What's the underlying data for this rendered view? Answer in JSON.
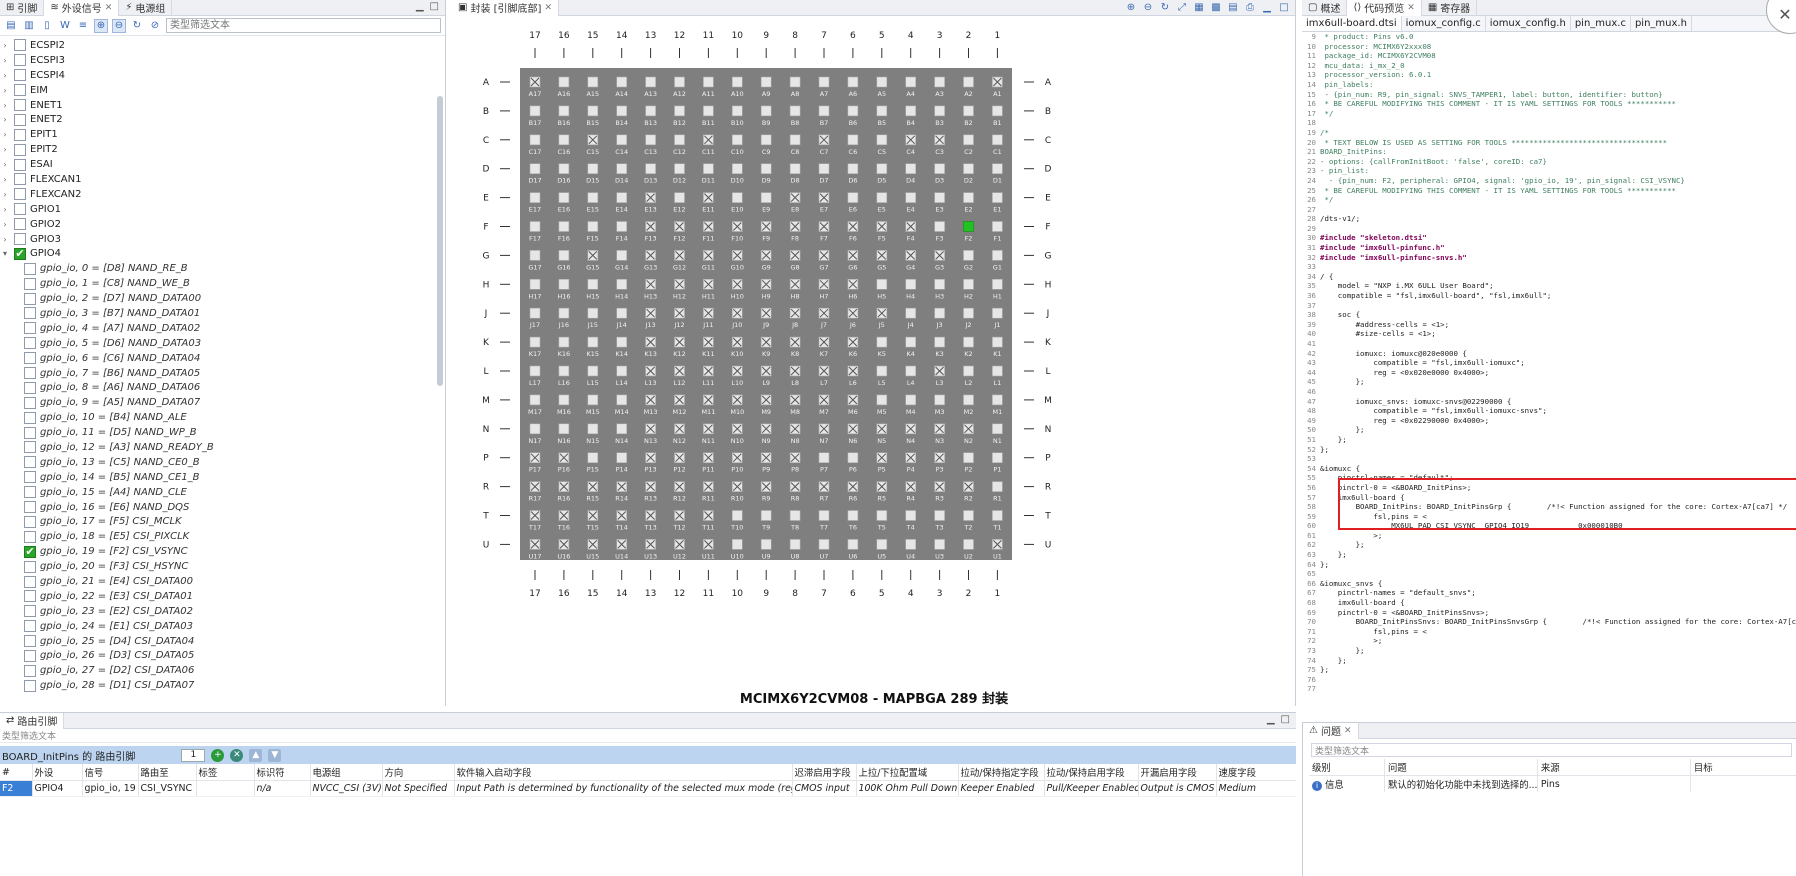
{
  "left_panel": {
    "tabs": [
      {
        "label": "引脚",
        "icon": "pin-icon"
      },
      {
        "label": "外设信号",
        "icon": "signal-icon",
        "active": true
      },
      {
        "label": "电源组",
        "icon": "power-icon"
      }
    ],
    "filter_placeholder": "类型筛选文本",
    "tree": [
      {
        "label": "ECSPI2",
        "checked": false
      },
      {
        "label": "ECSPI3",
        "checked": false
      },
      {
        "label": "ECSPI4",
        "checked": false
      },
      {
        "label": "EIM",
        "checked": false
      },
      {
        "label": "ENET1",
        "checked": false
      },
      {
        "label": "ENET2",
        "checked": false
      },
      {
        "label": "EPIT1",
        "checked": false
      },
      {
        "label": "EPIT2",
        "checked": false
      },
      {
        "label": "ESAI",
        "checked": false
      },
      {
        "label": "FLEXCAN1",
        "checked": false
      },
      {
        "label": "FLEXCAN2",
        "checked": false
      },
      {
        "label": "GPIO1",
        "checked": false
      },
      {
        "label": "GPIO2",
        "checked": false
      },
      {
        "label": "GPIO3",
        "checked": false
      },
      {
        "label": "GPIO4",
        "checked": true,
        "expanded": true
      },
      {
        "label": "gpio_io, 0 = [D8] NAND_RE_B",
        "child": true
      },
      {
        "label": "gpio_io, 1 = [C8] NAND_WE_B",
        "child": true
      },
      {
        "label": "gpio_io, 2 = [D7] NAND_DATA00",
        "child": true
      },
      {
        "label": "gpio_io, 3 = [B7] NAND_DATA01",
        "child": true
      },
      {
        "label": "gpio_io, 4 = [A7] NAND_DATA02",
        "child": true
      },
      {
        "label": "gpio_io, 5 = [D6] NAND_DATA03",
        "child": true
      },
      {
        "label": "gpio_io, 6 = [C6] NAND_DATA04",
        "child": true
      },
      {
        "label": "gpio_io, 7 = [B6] NAND_DATA05",
        "child": true
      },
      {
        "label": "gpio_io, 8 = [A6] NAND_DATA06",
        "child": true
      },
      {
        "label": "gpio_io, 9 = [A5] NAND_DATA07",
        "child": true
      },
      {
        "label": "gpio_io, 10 = [B4] NAND_ALE",
        "child": true
      },
      {
        "label": "gpio_io, 11 = [D5] NAND_WP_B",
        "child": true
      },
      {
        "label": "gpio_io, 12 = [A3] NAND_READY_B",
        "child": true
      },
      {
        "label": "gpio_io, 13 = [C5] NAND_CE0_B",
        "child": true
      },
      {
        "label": "gpio_io, 14 = [B5] NAND_CE1_B",
        "child": true
      },
      {
        "label": "gpio_io, 15 = [A4] NAND_CLE",
        "child": true
      },
      {
        "label": "gpio_io, 16 = [E6] NAND_DQS",
        "child": true
      },
      {
        "label": "gpio_io, 17 = [F5] CSI_MCLK",
        "child": true
      },
      {
        "label": "gpio_io, 18 = [E5] CSI_PIXCLK",
        "child": true
      },
      {
        "label": "gpio_io, 19 = [F2] CSI_VSYNC",
        "child": true,
        "checked": true
      },
      {
        "label": "gpio_io, 20 = [F3] CSI_HSYNC",
        "child": true
      },
      {
        "label": "gpio_io, 21 = [E4] CSI_DATA00",
        "child": true
      },
      {
        "label": "gpio_io, 22 = [E3] CSI_DATA01",
        "child": true
      },
      {
        "label": "gpio_io, 23 = [E2] CSI_DATA02",
        "child": true
      },
      {
        "label": "gpio_io, 24 = [E1] CSI_DATA03",
        "child": true
      },
      {
        "label": "gpio_io, 25 = [D4] CSI_DATA04",
        "child": true
      },
      {
        "label": "gpio_io, 26 = [D3] CSI_DATA05",
        "child": true
      },
      {
        "label": "gpio_io, 27 = [D2] CSI_DATA06",
        "child": true
      },
      {
        "label": "gpio_io, 28 = [D1] CSI_DATA07",
        "child": true
      }
    ]
  },
  "center_panel": {
    "tab_label": "封装 [引脚底部]",
    "package_title": "MCIMX6Y2CVM08 - MAPBGA 289 封装",
    "rows": [
      "A",
      "B",
      "C",
      "D",
      "E",
      "F",
      "G",
      "H",
      "J",
      "K",
      "L",
      "M",
      "N",
      "P",
      "R",
      "T",
      "U"
    ],
    "cols": [
      "17",
      "16",
      "15",
      "14",
      "13",
      "12",
      "11",
      "10",
      "9",
      "8",
      "7",
      "6",
      "5",
      "4",
      "3",
      "2",
      "1"
    ],
    "selected_pin": "F2",
    "crossed_pins": [
      "A17",
      "A1",
      "C15",
      "C11",
      "C7",
      "C4",
      "C3",
      "E13",
      "E11",
      "E8",
      "E7",
      "F13",
      "F12",
      "F11",
      "F10",
      "F9",
      "F8",
      "F7",
      "F6",
      "F5",
      "F4",
      "G15",
      "G13",
      "G12",
      "G11",
      "G10",
      "G9",
      "G8",
      "G7",
      "G6",
      "G5",
      "G4",
      "G3",
      "H13",
      "H12",
      "H11",
      "H10",
      "H9",
      "H8",
      "H7",
      "H6",
      "J13",
      "J12",
      "J11",
      "J10",
      "J9",
      "J8",
      "J7",
      "J6",
      "J5",
      "K13",
      "K12",
      "K11",
      "K10",
      "K9",
      "K8",
      "K7",
      "K6",
      "L13",
      "L12",
      "L11",
      "L10",
      "L9",
      "L8",
      "L7",
      "L6",
      "L3",
      "M13",
      "M12",
      "M11",
      "M10",
      "M9",
      "M8",
      "M7",
      "M6",
      "N13",
      "N12",
      "N11",
      "N10",
      "N9",
      "N8",
      "N7",
      "N6",
      "N5",
      "N4",
      "N3",
      "N2",
      "P17",
      "P16",
      "P13",
      "P12",
      "P11",
      "P10",
      "P9",
      "P8",
      "P5",
      "P4",
      "P3",
      "R17",
      "R16",
      "R15",
      "R14",
      "R13",
      "R12",
      "R11",
      "R10",
      "R9",
      "R8",
      "R7",
      "R6",
      "R5",
      "R4",
      "R3",
      "R2",
      "T17",
      "T16",
      "T15",
      "T14",
      "T13",
      "T12",
      "T11",
      "U17",
      "U16",
      "U15",
      "U14",
      "U13",
      "U12",
      "U11",
      "U1"
    ]
  },
  "right_panel": {
    "tabs": [
      {
        "label": "概述",
        "icon": "overview-icon"
      },
      {
        "label": "代码预览",
        "icon": "code-icon",
        "active": true
      },
      {
        "label": "寄存器",
        "icon": "register-icon"
      }
    ],
    "file_tabs": [
      "imx6ull-board.dtsi",
      "iomux_config.c",
      "iomux_config.h",
      "pin_mux.c",
      "pin_mux.h"
    ],
    "code_lines": [
      {
        "n": "9",
        "t": " * product: Pins v6.0",
        "c": "cmt"
      },
      {
        "n": "10",
        "t": " processor: MCIMX6Y2xxx08",
        "c": "cmt"
      },
      {
        "n": "11",
        "t": " package_id: MCIMX6Y2CVM08",
        "c": "cmt"
      },
      {
        "n": "12",
        "t": " mcu_data: i_mx_2_0",
        "c": "cmt"
      },
      {
        "n": "13",
        "t": " processor_version: 6.0.1",
        "c": "cmt"
      },
      {
        "n": "14",
        "t": " pin_labels:",
        "c": "cmt"
      },
      {
        "n": "15",
        "t": " - {pin_num: R9, pin_signal: SNVS_TAMPER1, label: button, identifier: button}",
        "c": "cmt"
      },
      {
        "n": "16",
        "t": " * BE CAREFUL MODIFYING THIS COMMENT - IT IS YAML SETTINGS FOR TOOLS ***********",
        "c": "cmt"
      },
      {
        "n": "17",
        "t": " */",
        "c": "cmt"
      },
      {
        "n": "18",
        "t": "",
        "c": ""
      },
      {
        "n": "19",
        "t": "/*",
        "c": "cmt"
      },
      {
        "n": "20",
        "t": " * TEXT BELOW IS USED AS SETTING FOR TOOLS ***********************************",
        "c": "cmt"
      },
      {
        "n": "21",
        "t": "BOARD_InitPins:",
        "c": "cmt"
      },
      {
        "n": "22",
        "t": "- options: {callFromInitBoot: 'false', coreID: ca7}",
        "c": "cmt"
      },
      {
        "n": "23",
        "t": "- pin_list:",
        "c": "cmt"
      },
      {
        "n": "24",
        "t": "  - {pin_num: F2, peripheral: GPIO4, signal: 'gpio_io, 19', pin_signal: CSI_VSYNC}",
        "c": "cmt"
      },
      {
        "n": "25",
        "t": " * BE CAREFUL MODIFYING THIS COMMENT - IT IS YAML SETTINGS FOR TOOLS ***********",
        "c": "cmt"
      },
      {
        "n": "26",
        "t": " */",
        "c": "cmt"
      },
      {
        "n": "27",
        "t": "",
        "c": ""
      },
      {
        "n": "28",
        "t": "/dts-v1/;",
        "c": ""
      },
      {
        "n": "29",
        "t": "",
        "c": ""
      },
      {
        "n": "30",
        "t": "#include \"skeleton.dtsi\"",
        "c": "kw"
      },
      {
        "n": "31",
        "t": "#include \"imx6ull-pinfunc.h\"",
        "c": "kw"
      },
      {
        "n": "32",
        "t": "#include \"imx6ull-pinfunc-snvs.h\"",
        "c": "kw"
      },
      {
        "n": "33",
        "t": "",
        "c": ""
      },
      {
        "n": "34",
        "t": "/ {",
        "c": ""
      },
      {
        "n": "35",
        "t": "    model = \"NXP i.MX 6ULL User Board\";",
        "c": ""
      },
      {
        "n": "36",
        "t": "    compatible = \"fsl,imx6ull-board\", \"fsl,imx6ull\";",
        "c": ""
      },
      {
        "n": "37",
        "t": "",
        "c": ""
      },
      {
        "n": "38",
        "t": "    soc {",
        "c": ""
      },
      {
        "n": "39",
        "t": "        #address-cells = <1>;",
        "c": ""
      },
      {
        "n": "40",
        "t": "        #size-cells = <1>;",
        "c": ""
      },
      {
        "n": "41",
        "t": "",
        "c": ""
      },
      {
        "n": "42",
        "t": "        iomuxc: iomuxc@020e0000 {",
        "c": ""
      },
      {
        "n": "43",
        "t": "            compatible = \"fsl,imx6ull-iomuxc\";",
        "c": ""
      },
      {
        "n": "44",
        "t": "            reg = <0x020e0000 0x4000>;",
        "c": ""
      },
      {
        "n": "45",
        "t": "        };",
        "c": ""
      },
      {
        "n": "46",
        "t": "",
        "c": ""
      },
      {
        "n": "47",
        "t": "        iomuxc_snvs: iomuxc-snvs@02290000 {",
        "c": ""
      },
      {
        "n": "48",
        "t": "            compatible = \"fsl,imx6ull-iomuxc-snvs\";",
        "c": ""
      },
      {
        "n": "49",
        "t": "            reg = <0x02290000 0x4000>;",
        "c": ""
      },
      {
        "n": "50",
        "t": "        };",
        "c": ""
      },
      {
        "n": "51",
        "t": "    };",
        "c": ""
      },
      {
        "n": "52",
        "t": "};",
        "c": ""
      },
      {
        "n": "53",
        "t": "",
        "c": ""
      },
      {
        "n": "54",
        "t": "&iomuxc {",
        "c": ""
      },
      {
        "n": "55",
        "t": "    pinctrl-names = \"default\";",
        "c": ""
      },
      {
        "n": "56",
        "t": "    pinctrl-0 = <&BOARD_InitPins>;",
        "c": ""
      },
      {
        "n": "57",
        "t": "    imx6ull-board {",
        "c": ""
      },
      {
        "n": "58",
        "t": "        BOARD_InitPins: BOARD_InitPinsGrp {        /*!< Function assigned for the core: Cortex-A7[ca7] */",
        "c": ""
      },
      {
        "n": "59",
        "t": "            fsl,pins = <",
        "c": ""
      },
      {
        "n": "60",
        "t": "                MX6UL_PAD_CSI_VSYNC__GPIO4_IO19           0x000010B0",
        "c": ""
      },
      {
        "n": "61",
        "t": "            >;",
        "c": ""
      },
      {
        "n": "62",
        "t": "        };",
        "c": ""
      },
      {
        "n": "63",
        "t": "    };",
        "c": ""
      },
      {
        "n": "64",
        "t": "};",
        "c": ""
      },
      {
        "n": "65",
        "t": "",
        "c": ""
      },
      {
        "n": "66",
        "t": "&iomuxc_snvs {",
        "c": ""
      },
      {
        "n": "67",
        "t": "    pinctrl-names = \"default_snvs\";",
        "c": ""
      },
      {
        "n": "68",
        "t": "    imx6ull-board {",
        "c": ""
      },
      {
        "n": "69",
        "t": "    pinctrl-0 = <&BOARD_InitPinsSnvs>;",
        "c": ""
      },
      {
        "n": "70",
        "t": "        BOARD_InitPinsSnvs: BOARD_InitPinsSnvsGrp {        /*!< Function assigned for the core: Cortex-A7[ca7] */",
        "c": ""
      },
      {
        "n": "71",
        "t": "            fsl,pins = <",
        "c": ""
      },
      {
        "n": "72",
        "t": "            >;",
        "c": ""
      },
      {
        "n": "73",
        "t": "        };",
        "c": ""
      },
      {
        "n": "74",
        "t": "    };",
        "c": ""
      },
      {
        "n": "75",
        "t": "};",
        "c": ""
      },
      {
        "n": "76",
        "t": "",
        "c": ""
      },
      {
        "n": "77",
        "t": "",
        "c": ""
      }
    ]
  },
  "bottom_panel": {
    "tab_label": "路由引脚",
    "filter_placeholder": "类型筛选文本",
    "route_title": "BOARD_InitPins 的 路由引脚",
    "route_count": "1",
    "columns": [
      "#",
      "外设",
      "信号",
      "路由至",
      "标签",
      "标识符",
      "电源组",
      "方向",
      "软件输入启动字段",
      "迟滞启用字段",
      "上拉/下拉配置域",
      "拉动/保持指定字段",
      "拉动/保持启用字段",
      "开漏启用字段",
      "速度字段"
    ],
    "rows": [
      [
        "F2",
        "GPIO4",
        "gpio_io, 19",
        "CSI_VSYNC",
        "",
        "n/a",
        "NVCC_CSI (3V)",
        "Not Specified",
        "Input Path is determined by functionality of the selected mux mode (regular)",
        "CMOS input",
        "100K Ohm Pull Down",
        "Keeper Enabled",
        "Pull/Keeper Enabled",
        "Output is CMOS",
        "Medium"
      ]
    ]
  },
  "problems_panel": {
    "tab_label": "问题",
    "filter_placeholder": "类型筛选文本",
    "columns": [
      "级别",
      "问题",
      "来源",
      "目标"
    ],
    "rows": [
      [
        "信息",
        "默认的初始化功能中未找到选择的...",
        "Pins",
        ""
      ]
    ]
  }
}
